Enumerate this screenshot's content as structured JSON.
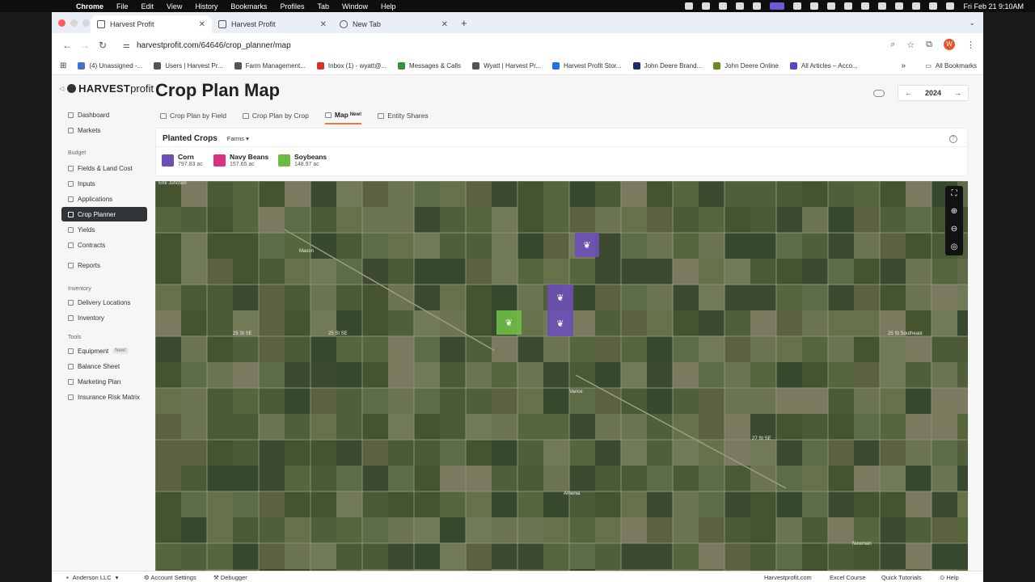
{
  "os_menu": {
    "apple": "",
    "items": [
      "Chrome",
      "File",
      "Edit",
      "View",
      "History",
      "Bookmarks",
      "Profiles",
      "Tab",
      "Window",
      "Help"
    ],
    "datetime": "Fri Feb 21  9:10AM"
  },
  "browser": {
    "tabs": [
      {
        "title": "Harvest Profit",
        "active": true
      },
      {
        "title": "Harvest Profit",
        "active": false
      },
      {
        "title": "New Tab",
        "active": false
      }
    ],
    "url": "harvestprofit.com/64646/crop_planner/map",
    "profile_initial": "W",
    "bookmarks": [
      {
        "label": "(4) Unassigned -...",
        "color": "#4a6fd1"
      },
      {
        "label": "Users | Harvest Pr...",
        "color": "#555555"
      },
      {
        "label": "Farm Management...",
        "color": "#555555"
      },
      {
        "label": "Inbox (1) - wyatt@...",
        "color": "#d93025"
      },
      {
        "label": "Messages & Calls",
        "color": "#3b8f3b"
      },
      {
        "label": "Wyatt | Harvest Pr...",
        "color": "#555555"
      },
      {
        "label": "Harvest Profit Stor...",
        "color": "#1a73e8"
      },
      {
        "label": "John Deere Brand...",
        "color": "#1d2a6b"
      },
      {
        "label": "John Deere Online",
        "color": "#6a8b1a"
      },
      {
        "label": "All Articles – Acco...",
        "color": "#5a45c9"
      }
    ],
    "bookmarks_more": "»",
    "all_bookmarks": "All Bookmarks"
  },
  "brand": {
    "strong": "HARVEST",
    "light": "profit"
  },
  "sidebar": {
    "items_top": [
      {
        "label": "Dashboard",
        "icon": "dashboard-icon"
      },
      {
        "label": "Markets",
        "icon": "markets-icon"
      }
    ],
    "budget_label": "Budget",
    "budget_items": [
      {
        "label": "Fields & Land Cost",
        "icon": "fields-icon",
        "active": false
      },
      {
        "label": "Inputs",
        "icon": "inputs-icon",
        "active": false
      },
      {
        "label": "Applications",
        "icon": "applications-icon",
        "active": false
      },
      {
        "label": "Crop Planner",
        "icon": "crop-planner-icon",
        "active": true
      },
      {
        "label": "Yields",
        "icon": "yields-icon",
        "active": false
      },
      {
        "label": "Contracts",
        "icon": "contracts-icon",
        "active": false
      }
    ],
    "reports": "Reports",
    "inventory_label": "Inventory",
    "inventory_items": [
      {
        "label": "Delivery Locations",
        "icon": "delivery-icon"
      },
      {
        "label": "Inventory",
        "icon": "inventory-icon"
      }
    ],
    "tools_label": "Tools",
    "tools_items": [
      {
        "label": "Equipment",
        "icon": "equipment-icon",
        "badge": "New!"
      },
      {
        "label": "Balance Sheet",
        "icon": "balance-sheet-icon"
      },
      {
        "label": "Marketing Plan",
        "icon": "marketing-plan-icon"
      },
      {
        "label": "Insurance Risk Matrix",
        "icon": "insurance-icon"
      }
    ]
  },
  "page": {
    "title": "Crop Plan Map",
    "year": "2024",
    "tabs": [
      {
        "label": "Crop Plan by Field",
        "active": false
      },
      {
        "label": "Crop Plan by Crop",
        "active": false
      },
      {
        "label": "Map",
        "active": true,
        "badge": "New!"
      },
      {
        "label": "Entity Shares",
        "active": false
      }
    ]
  },
  "planted": {
    "title": "Planted Crops",
    "filter": "Farms",
    "crops": [
      {
        "name": "Corn",
        "acres": "797.83 ac",
        "color": "#6a4fb5"
      },
      {
        "name": "Navy Beans",
        "acres": "157.65 ac",
        "color": "#d63384"
      },
      {
        "name": "Soybeans",
        "acres": "148.97 ac",
        "color": "#6dbb45"
      }
    ]
  },
  "map": {
    "labels": [
      "Erie Junction",
      "Mason",
      "Vance",
      "Amenia",
      "Newman"
    ],
    "road_labels": [
      "25 St SE",
      "25 St SE",
      "25 St Southeast",
      "27 St SE"
    ],
    "controls": [
      "fullscreen-icon",
      "zoom-in-icon",
      "zoom-out-icon",
      "locate-icon"
    ]
  },
  "footer": {
    "org": "Anderson LLC",
    "account_settings": "Account Settings",
    "debugger": "Debugger",
    "links": [
      "Harvestprofit.com",
      "Excel Course",
      "Quick Tutorials",
      "Help"
    ]
  }
}
